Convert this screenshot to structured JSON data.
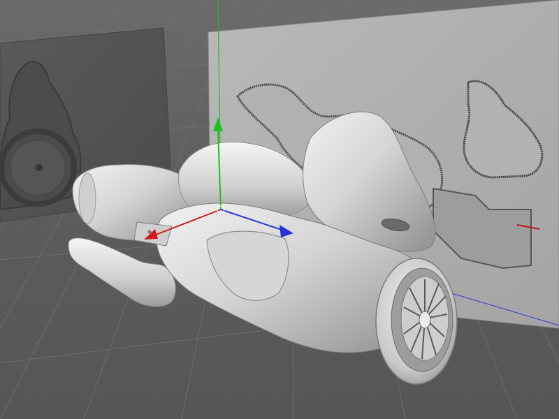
{
  "viewport": {
    "background_color": "#5e5e5e",
    "grid_color": "#6c6c6c",
    "axis_x_color": "#d21a1a",
    "axis_y_color": "#1fbf1f",
    "axis_z_color": "#2a32d8",
    "model_color": "#d8d8d8"
  },
  "icons": {
    "world_origin": "world-origin-icon",
    "gizmo": "move-gizmo-icon"
  }
}
